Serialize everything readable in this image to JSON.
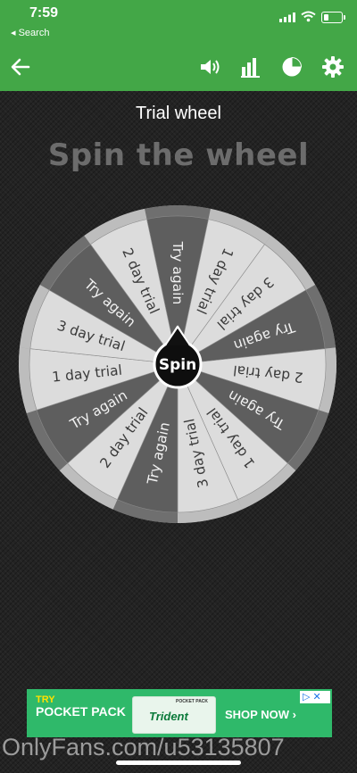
{
  "status_bar": {
    "time": "7:59",
    "back_label": "◂ Search"
  },
  "app_bar": {
    "back_icon": "arrow-left-icon",
    "actions": [
      "volume-icon",
      "bar-chart-icon",
      "pie-chart-icon",
      "gear-icon"
    ]
  },
  "wheel": {
    "title": "Trial wheel",
    "heading": "Spin the wheel",
    "spin_label": "Spin",
    "segments": [
      "Try again",
      "1 day trial",
      "3 day trial",
      "Try again",
      "2 day trial",
      "Try again",
      "1 day trial",
      "3 day trial",
      "Try again",
      "2 day trial",
      "Try again",
      "1 day trial",
      "3 day trial",
      "Try again",
      "2 day trial"
    ]
  },
  "ad": {
    "line1": "TRY",
    "line2": "POCKET PACK",
    "pack_label": "POCKET PACK",
    "brand": "Trident",
    "cta": "SHOP NOW ›",
    "adchoices": "▷ ✕"
  },
  "watermark": "OnlyFans.com/u53135807",
  "colors": {
    "accent": "#43a747",
    "segment_dark": "#5e5e5e",
    "segment_light": "#dcdcdc",
    "rim": "#9a9a9a",
    "ad_bg": "#2fb96a"
  }
}
